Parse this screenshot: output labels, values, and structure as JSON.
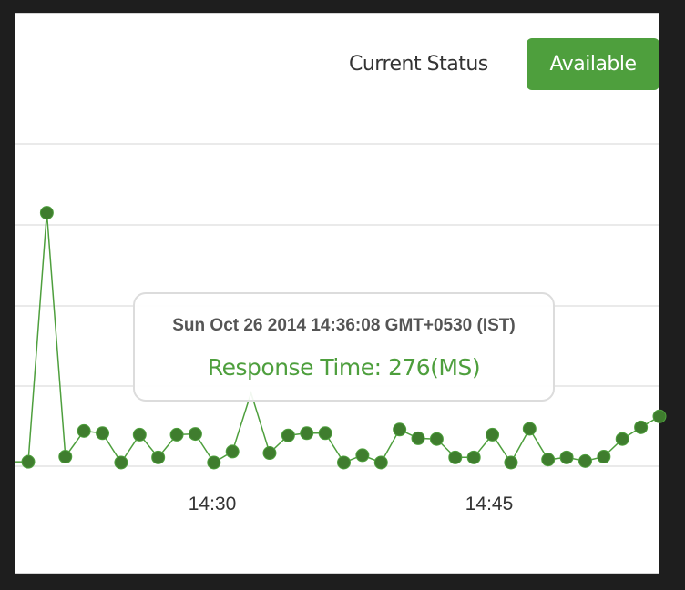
{
  "status": {
    "label": "Current Status",
    "value": "Available",
    "color": "#4e9f3d"
  },
  "tooltip": {
    "date": "Sun Oct 26 2014 14:36:08 GMT+0530 (IST)",
    "value": "Response Time: 276(MS)"
  },
  "chart_data": {
    "type": "line",
    "title": "",
    "xlabel": "",
    "ylabel": "",
    "x_tick_labels": [
      "14:30",
      "14:45"
    ],
    "grid": "horizontal",
    "line_color": "#4e9f3d",
    "y_unit": "MS",
    "series": [
      {
        "values": [
          30,
          1730,
          65,
          240,
          225,
          25,
          215,
          60,
          215,
          220,
          25,
          100,
          500,
          90,
          210,
          225,
          225,
          25,
          75,
          25,
          250,
          190,
          185,
          60,
          60,
          215,
          25,
          255,
          45,
          60,
          35,
          65,
          185,
          265,
          340
        ]
      }
    ]
  }
}
